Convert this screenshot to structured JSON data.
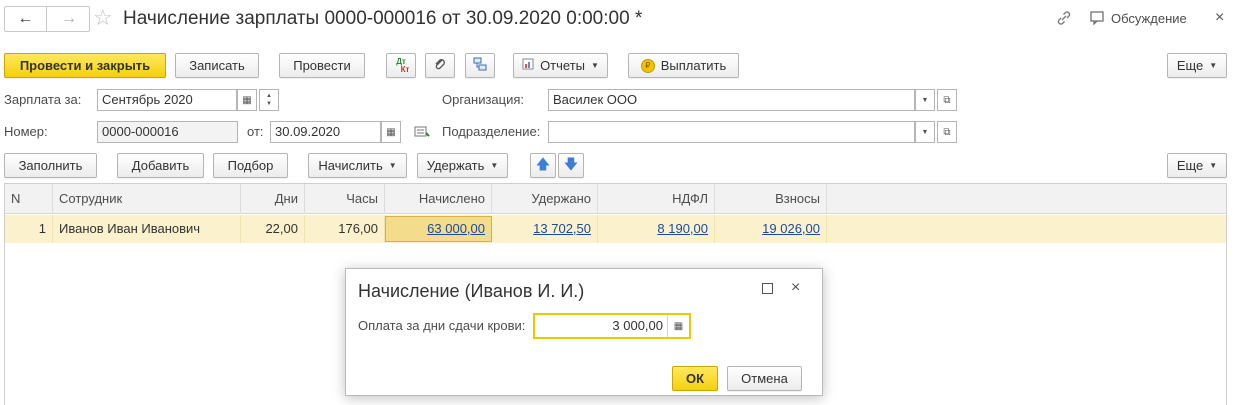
{
  "window": {
    "title": "Начисление зарплаты 0000-000016 от 30.09.2020 0:00:00 *",
    "discussion_label": "Обсуждение"
  },
  "toolbar": {
    "post_and_close": "Провести и закрыть",
    "save": "Записать",
    "post": "Провести",
    "dtkt_top": "Дт",
    "dtkt_bottom": "Кт",
    "reports": "Отчеты",
    "pay": "Выплатить",
    "more": "Еще"
  },
  "form": {
    "salary_for_label": "Зарплата за:",
    "salary_for_value": "Сентябрь 2020",
    "number_label": "Номер:",
    "number_value": "0000-000016",
    "date_label": "от:",
    "date_value": "30.09.2020",
    "organization_label": "Организация:",
    "organization_value": "Василек ООО",
    "department_label": "Подразделение:",
    "department_value": ""
  },
  "table_toolbar": {
    "fill": "Заполнить",
    "add": "Добавить",
    "pick": "Подбор",
    "accrue": "Начислить",
    "withhold": "Удержать",
    "more": "Еще"
  },
  "table": {
    "columns": [
      "N",
      "Сотрудник",
      "Дни",
      "Часы",
      "Начислено",
      "Удержано",
      "НДФЛ",
      "Взносы"
    ],
    "rows": [
      {
        "n": "1",
        "employee": "Иванов Иван Иванович",
        "days": "22,00",
        "hours": "176,00",
        "accrued": "63 000,00",
        "withheld": "13 702,50",
        "ndfl": "8 190,00",
        "contributions": "19 026,00"
      }
    ]
  },
  "dialog": {
    "title": "Начисление (Иванов И. И.)",
    "field_label": "Оплата за дни сдачи крови:",
    "field_value": "3 000,00",
    "ok": "ОК",
    "cancel": "Отмена"
  },
  "colors": {
    "accent_yellow": "#f5d00b",
    "selected_row": "#fbf1cc",
    "link": "#1c4b9b"
  }
}
